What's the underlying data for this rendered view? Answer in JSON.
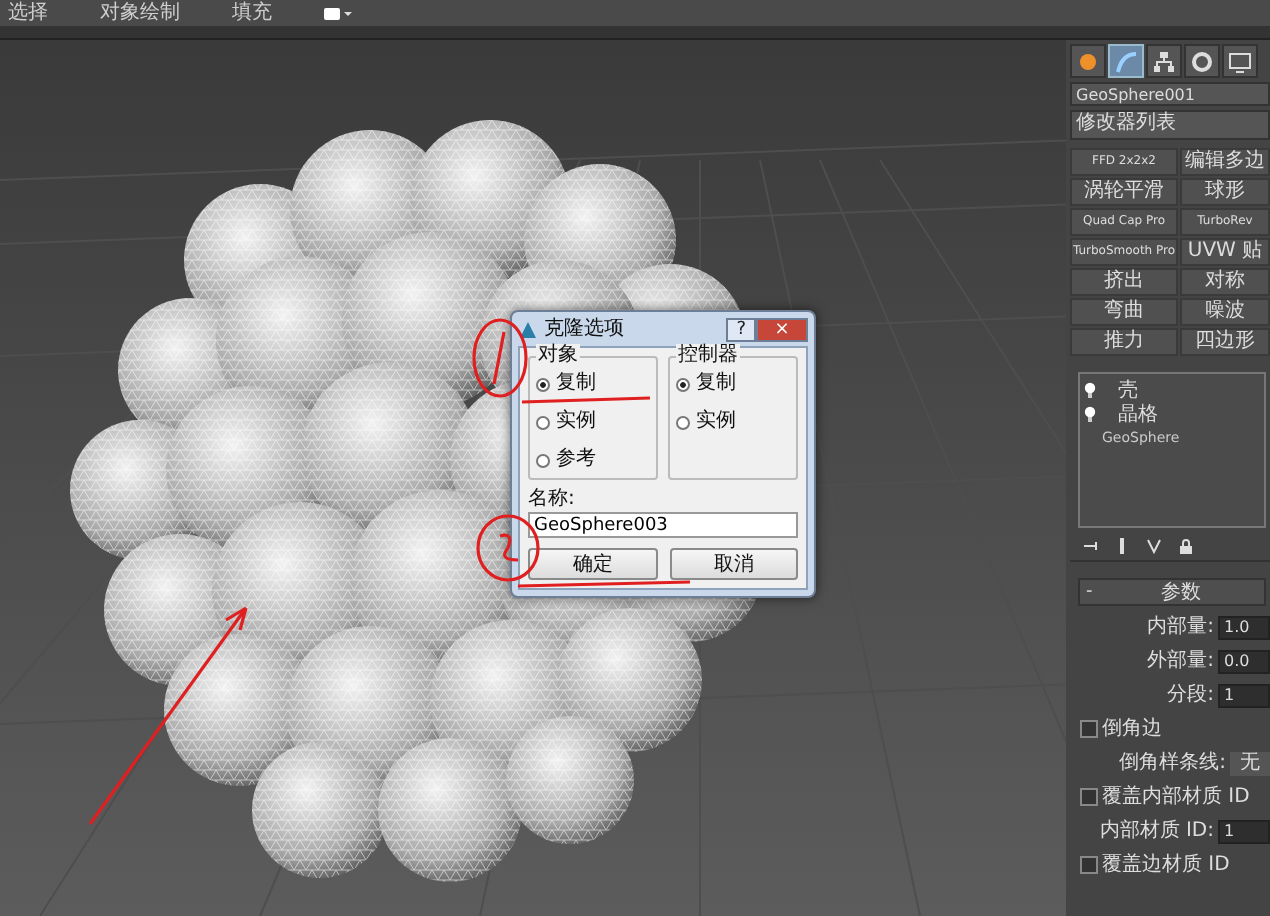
{
  "menu": [
    "选择",
    "对象绘制",
    "填充"
  ],
  "command_panel": {
    "tabs": [
      {
        "selected": false
      },
      {
        "selected": true
      },
      {
        "selected": false
      },
      {
        "selected": false
      },
      {
        "selected": false
      }
    ],
    "object_name": "GeoSphere001",
    "modifier_list": "修改器列表",
    "modifier_buttons": [
      "FFD 2x2x2",
      "编辑多边",
      "涡轮平滑",
      "球形",
      "Quad Cap Pro",
      "TurboRev",
      "TurboSmooth Pro",
      "UVW 贴",
      "挤出",
      "对称",
      "弯曲",
      "噪波",
      "推力",
      "四边形"
    ],
    "stack": [
      {
        "label": "壳",
        "kind": "modifier"
      },
      {
        "label": "晶格",
        "kind": "modifier"
      },
      {
        "label": "GeoSphere",
        "kind": "base"
      }
    ],
    "rollout": {
      "toggle": "-",
      "title": "参数"
    },
    "params": [
      {
        "kind": "spinner",
        "label": "内部量:",
        "value": "1.0"
      },
      {
        "kind": "spinner",
        "label": "外部量:",
        "value": "0.0"
      },
      {
        "kind": "spinner",
        "label": "分段:",
        "value": "1"
      },
      {
        "kind": "checkbox",
        "label": "倒角边",
        "checked": false
      },
      {
        "kind": "dropdown",
        "label": "倒角样条线:",
        "value": "无"
      },
      {
        "kind": "checkbox",
        "label": "覆盖内部材质 ID",
        "checked": false
      },
      {
        "kind": "spinner",
        "label": "内部材质 ID:",
        "value": "1"
      },
      {
        "kind": "checkbox",
        "label": "覆盖边材质 ID",
        "checked": false
      }
    ]
  },
  "dialog": {
    "title": "克隆选项",
    "help": "?",
    "close": "×",
    "groups": [
      {
        "title": "对象",
        "options": [
          {
            "label": "复制",
            "selected": true
          },
          {
            "label": "实例",
            "selected": false
          },
          {
            "label": "参考",
            "selected": false
          }
        ]
      },
      {
        "title": "控制器",
        "options": [
          {
            "label": "复制",
            "selected": true
          },
          {
            "label": "实例",
            "selected": false
          }
        ]
      }
    ],
    "name_label": "名称:",
    "name_value": "GeoSphere003",
    "buttons": [
      "确定",
      "取消"
    ]
  }
}
